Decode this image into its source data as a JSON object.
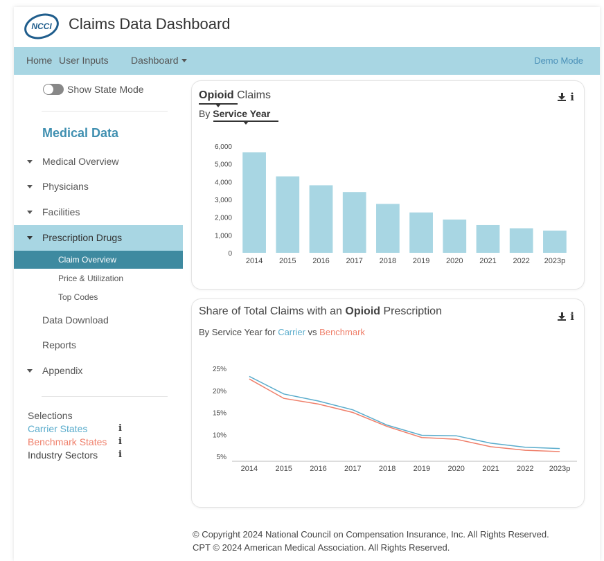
{
  "app": {
    "title": "Claims Data Dashboard",
    "logo_text": "NCCI"
  },
  "nav": {
    "home": "Home",
    "user_inputs": "User Inputs",
    "dashboard": "Dashboard",
    "mode": "Demo Mode"
  },
  "sidebar": {
    "toggle_label": "Show State Mode",
    "toggle_on": false,
    "section_title": "Medical Data",
    "items": {
      "overview": "Medical Overview",
      "physicians": "Physicians",
      "facilities": "Facilities",
      "rx": "Prescription Drugs",
      "claim_overview": "Claim Overview",
      "price": "Price & Utilization",
      "top_codes": "Top Codes",
      "download": "Data Download",
      "reports": "Reports",
      "appendix": "Appendix"
    },
    "selections": {
      "title": "Selections",
      "carrier": "Carrier States",
      "benchmark": "Benchmark States",
      "industry": "Industry Sectors",
      "info": "i"
    }
  },
  "card1": {
    "title_bold": "Opioid",
    "title_rest": "Claims",
    "sub_prefix": "By",
    "sub_bold": "Service Year",
    "info": "i"
  },
  "card2": {
    "title_prefix": "Share of Total Claims with an",
    "title_bold": "Opioid",
    "title_suffix": "Prescription",
    "sub_prefix": "By Service Year for",
    "sub_carrier": "Carrier",
    "sub_vs": "vs",
    "sub_benchmark": "Benchmark",
    "info": "i"
  },
  "colors": {
    "bar": "#a8d6e3",
    "carrier": "#5aaccc",
    "benchmark": "#ef7f6a",
    "nav": "#a8d6e3",
    "active": "#3e8aa0"
  },
  "chart_data": [
    {
      "type": "bar",
      "categories": [
        "2014",
        "2015",
        "2016",
        "2017",
        "2018",
        "2019",
        "2020",
        "2021",
        "2022",
        "2023p"
      ],
      "values": [
        5650,
        4300,
        3800,
        3420,
        2750,
        2270,
        1870,
        1560,
        1380,
        1250
      ],
      "yticks": [
        "6,000",
        "5,000",
        "4,000",
        "3,000",
        "2,000",
        "1,000",
        "0"
      ],
      "ylim": [
        0,
        6000
      ],
      "grid": false
    },
    {
      "type": "line",
      "categories": [
        "2014",
        "2015",
        "2016",
        "2017",
        "2018",
        "2019",
        "2020",
        "2021",
        "2022",
        "2023p"
      ],
      "series": [
        {
          "name": "Carrier",
          "values": [
            23.2,
            19.2,
            17.6,
            15.6,
            12.1,
            9.8,
            9.7,
            8.0,
            7.1,
            6.8
          ]
        },
        {
          "name": "Benchmark",
          "values": [
            22.6,
            18.2,
            16.9,
            15.0,
            11.8,
            9.3,
            8.9,
            7.2,
            6.4,
            6.1
          ]
        }
      ],
      "yticks": [
        "25%",
        "20%",
        "15%",
        "10%",
        "5%"
      ],
      "ylim": [
        5,
        25
      ],
      "grid": false
    }
  ],
  "footer": {
    "line1": "© Copyright 2024 National Council on Compensation Insurance, Inc. All Rights Reserved.",
    "line2": "CPT © 2024 American Medical Association. All Rights Reserved."
  }
}
